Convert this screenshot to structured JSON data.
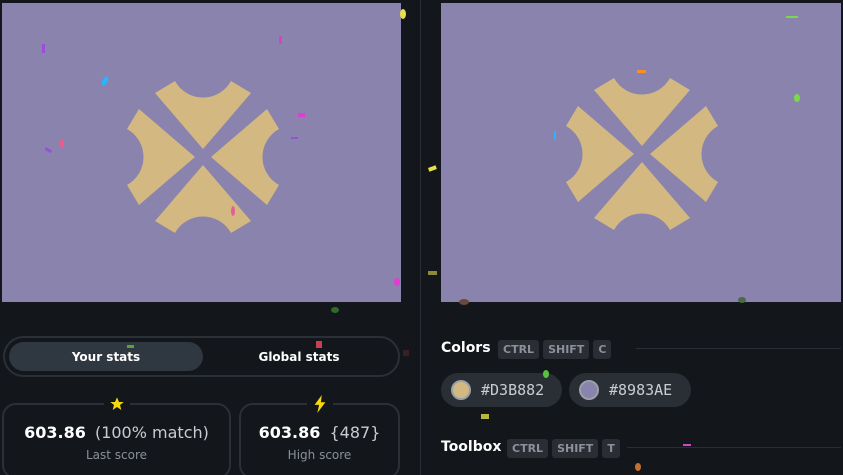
{
  "canvases": {
    "output_bg": "#8983AE",
    "target_bg": "#8983AE",
    "shape_color": "#D3B882"
  },
  "stats": {
    "tabs": [
      {
        "label": "Your stats"
      },
      {
        "label": "Global stats"
      }
    ],
    "cards": [
      {
        "icon": "star-icon",
        "value": "603.86",
        "sub": "(100% match)",
        "label": "Last score"
      },
      {
        "icon": "lightning-icon",
        "value": "603.86",
        "sub": "{487}",
        "label": "High score"
      }
    ]
  },
  "colors": {
    "title": "Colors",
    "shortcut": [
      "CTRL",
      "SHIFT",
      "C"
    ],
    "swatches": [
      {
        "hex": "#D3B882",
        "label": "#D3B882"
      },
      {
        "hex": "#8983AE",
        "label": "#8983AE"
      }
    ]
  },
  "toolbox": {
    "title": "Toolbox",
    "shortcut": [
      "CTRL",
      "SHIFT",
      "T"
    ]
  }
}
